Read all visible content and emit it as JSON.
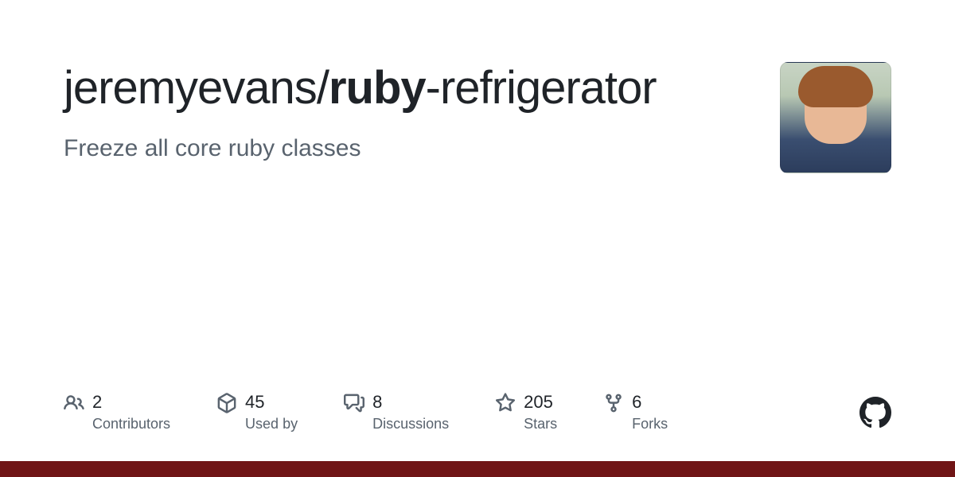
{
  "repo": {
    "owner": "jeremyevans",
    "slash": "/",
    "name_bold": "ruby",
    "name_rest": "-refrigerator",
    "description": "Freeze all core ruby classes"
  },
  "stats": [
    {
      "count": "2",
      "label": "Contributors"
    },
    {
      "count": "45",
      "label": "Used by"
    },
    {
      "count": "8",
      "label": "Discussions"
    },
    {
      "count": "205",
      "label": "Stars"
    },
    {
      "count": "6",
      "label": "Forks"
    }
  ],
  "accent_color": "#701516"
}
